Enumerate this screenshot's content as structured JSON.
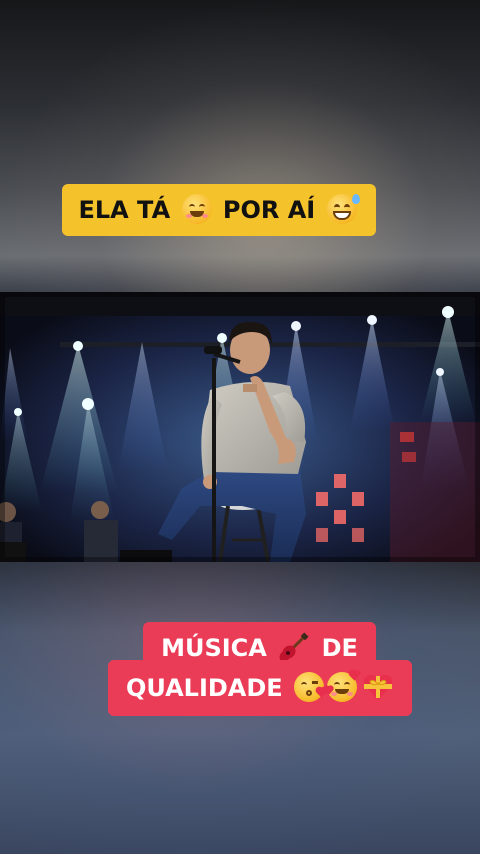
{
  "captions": {
    "top": {
      "text_before": "ELA TÁ",
      "text_after": "POR AÍ",
      "emoji_1": "smiling-face-icon",
      "emoji_2": "grinning-sweat-face-icon"
    },
    "bottom": {
      "line1_before": "MÚSICA",
      "line1_after": "DE",
      "line1_emoji": "guitar-icon",
      "line2_text": "QUALIDADE",
      "line2_emojis": [
        "face-blowing-kiss-icon",
        "smiling-face-with-hearts-icon",
        "heart-with-ribbon-icon"
      ]
    }
  },
  "colors": {
    "caption_top_bg": "#f4c22a",
    "caption_bottom_bg": "#ea3c57"
  },
  "video": {
    "description_icon": "concert-video-frame"
  }
}
